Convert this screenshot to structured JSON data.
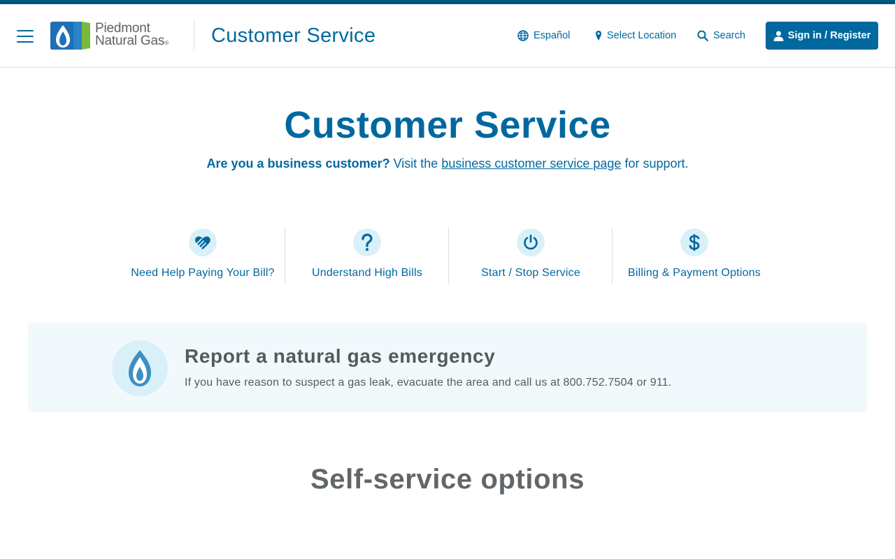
{
  "header": {
    "logo_text_line1": "Piedmont",
    "logo_text_line2": "Natural Gas",
    "logo_reg_mark": "®",
    "title": "Customer Service",
    "language_link": "Español",
    "location_link": "Select Location",
    "search_link": "Search",
    "signin_label": "Sign in / Register"
  },
  "hero": {
    "title": "Customer Service",
    "sub_bold": "Are you a business customer?",
    "sub_text1": " Visit the ",
    "sub_link": "business customer service page",
    "sub_text2": " for support."
  },
  "quick_links": [
    {
      "label": "Need Help Paying Your Bill?",
      "icon": "heart-hand-icon"
    },
    {
      "label": "Understand High Bills",
      "icon": "question-icon"
    },
    {
      "label": "Start / Stop Service",
      "icon": "power-icon"
    },
    {
      "label": "Billing & Payment Options",
      "icon": "dollar-icon"
    }
  ],
  "emergency": {
    "title": "Report a natural gas emergency",
    "text": "If you have reason to suspect a gas leak, evacuate the area and call us at 800.752.7504 or 911.",
    "icon": "flame-icon"
  },
  "section": {
    "title": "Self-service options"
  },
  "colors": {
    "brand_blue": "#00689f",
    "top_stripe": "#00577e",
    "icon_circle": "#daf0f8",
    "emergency_bg": "#f2f9fc",
    "gray_text": "#555a5e"
  }
}
